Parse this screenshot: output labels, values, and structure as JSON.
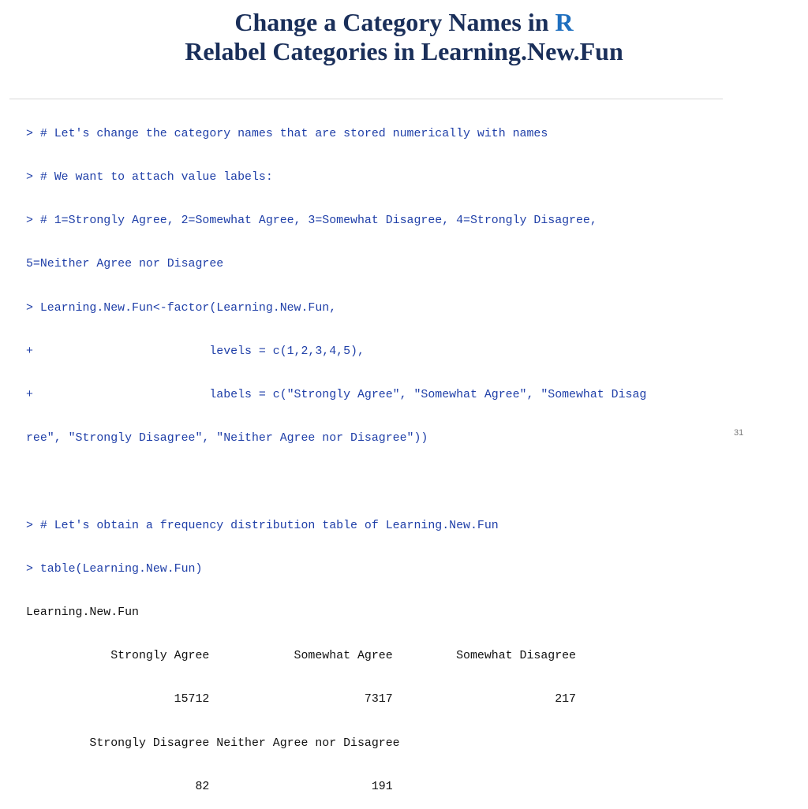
{
  "slide": {
    "title_line1_prefix": "Change a Category Names in ",
    "title_line1_accent": "R",
    "title_line2": "Relabel Categories in Learning.New.Fun",
    "colors": {
      "title": "#1a2f5a",
      "accent": "#1f6fbf",
      "command": "#1f3fa8",
      "output": "#111111"
    },
    "console_lines": [
      {
        "text": "> # Let's change the category names that are stored numerically with names",
        "kind": "cmd"
      },
      {
        "text": "> # We want to attach value labels:",
        "kind": "cmd"
      },
      {
        "text": "> # 1=Strongly Agree, 2=Somewhat Agree, 3=Somewhat Disagree, 4=Strongly Disagree,",
        "kind": "cmd"
      },
      {
        "text": "5=Neither Agree nor Disagree",
        "kind": "cmd"
      },
      {
        "text": "> Learning.New.Fun<-factor(Learning.New.Fun,",
        "kind": "cmd"
      },
      {
        "text": "+                         levels = c(1,2,3,4,5),",
        "kind": "cmd"
      },
      {
        "text": "+                         labels = c(\"Strongly Agree\", \"Somewhat Agree\", \"Somewhat Disag",
        "kind": "cmd"
      },
      {
        "text": "ree\", \"Strongly Disagree\", \"Neither Agree nor Disagree\"))",
        "kind": "cmd"
      },
      {
        "text": "",
        "kind": "cmd"
      },
      {
        "text": "> # Let's obtain a frequency distribution table of Learning.New.Fun",
        "kind": "cmd"
      },
      {
        "text": "> table(Learning.New.Fun)",
        "kind": "cmd"
      },
      {
        "text": "Learning.New.Fun",
        "kind": "out"
      },
      {
        "text": "            Strongly Agree            Somewhat Agree         Somewhat Disagree",
        "kind": "out"
      },
      {
        "text": "                     15712                      7317                       217",
        "kind": "out"
      },
      {
        "text": "         Strongly Disagree Neither Agree nor Disagree",
        "kind": "out"
      },
      {
        "text": "                        82                       191",
        "kind": "out"
      }
    ],
    "page_number": "31"
  }
}
